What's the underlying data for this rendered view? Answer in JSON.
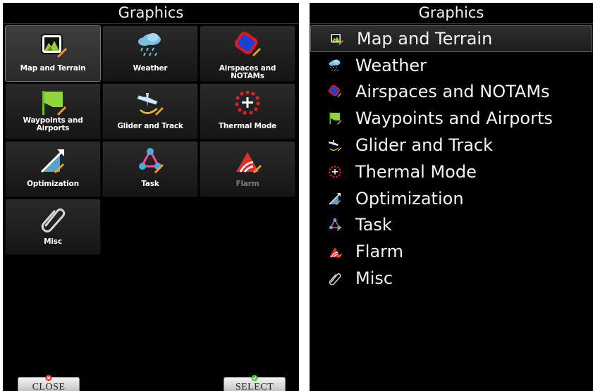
{
  "left": {
    "title": "Graphics",
    "tiles": [
      {
        "label": "Map and Terrain",
        "icon": "map-terrain-icon",
        "selected": true
      },
      {
        "label": "Weather",
        "icon": "weather-icon"
      },
      {
        "label": "Airspaces and NOTAMs",
        "icon": "airspace-icon"
      },
      {
        "label": "Waypoints and Airports",
        "icon": "waypoint-flag-icon"
      },
      {
        "label": "Glider and Track",
        "icon": "glider-icon"
      },
      {
        "label": "Thermal Mode",
        "icon": "thermal-icon"
      },
      {
        "label": "Optimization",
        "icon": "optimization-icon"
      },
      {
        "label": "Task",
        "icon": "task-icon"
      },
      {
        "label": "Flarm",
        "icon": "flarm-icon",
        "disabled": true
      },
      {
        "label": "Misc",
        "icon": "paperclip-icon"
      }
    ],
    "close_label": "CLOSE",
    "select_label": "SELECT"
  },
  "right": {
    "title": "Graphics",
    "items": [
      {
        "label": "Map and Terrain",
        "icon": "map-terrain-icon",
        "selected": true
      },
      {
        "label": "Weather",
        "icon": "weather-icon"
      },
      {
        "label": "Airspaces and NOTAMs",
        "icon": "airspace-icon"
      },
      {
        "label": "Waypoints and Airports",
        "icon": "waypoint-flag-icon"
      },
      {
        "label": "Glider and Track",
        "icon": "glider-icon"
      },
      {
        "label": "Thermal Mode",
        "icon": "thermal-icon"
      },
      {
        "label": "Optimization",
        "icon": "optimization-icon"
      },
      {
        "label": "Task",
        "icon": "task-icon"
      },
      {
        "label": "Flarm",
        "icon": "flarm-icon"
      },
      {
        "label": "Misc",
        "icon": "paperclip-icon"
      }
    ]
  },
  "colors": {
    "close_mark": "#e23b2e",
    "select_mark": "#4cbb3c",
    "disabled_text": "#7b7b7b"
  }
}
